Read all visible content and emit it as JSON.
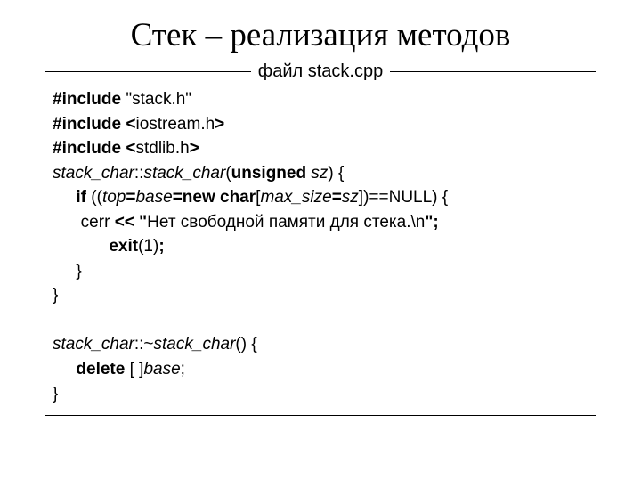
{
  "title": "Стек – реализация методов",
  "fileLabel": "файл stack.cpp",
  "code": {
    "l1a": "#include ",
    "l1b": "\"stack.h\"",
    "l2a": "#include ",
    "l2b": "<",
    "l2c": "iostream.h",
    "l2d": ">",
    "l3a": "#include ",
    "l3b": "<",
    "l3c": "stdlib.h",
    "l3d": ">",
    "l4a": "stack_char",
    "l4b": "::",
    "l4c": "stack_char",
    "l4d": "(",
    "l4e": "unsigned ",
    "l4f": "sz",
    "l4g": ") {",
    "l5a": "     ",
    "l5b": "if ",
    "l5c": "((",
    "l5d": "top",
    "l5e": "=",
    "l5f": "base",
    "l5g": "=new char",
    "l5h": "[",
    "l5i": "max_size",
    "l5j": "=",
    "l5k": "sz",
    "l5l": "])==NULL) {",
    "l6a": "      cerr ",
    "l6b": "<< \"",
    "l6c": "Нет свободной памяти для стека.\\n",
    "l6d": "\";",
    "l7a": "            exit",
    "l7b": "(1)",
    "l7c": ";",
    "l8": "     }",
    "l9": "}",
    "l10": " ",
    "l11a": "stack_char",
    "l11b": "::~",
    "l11c": "stack_char",
    "l11d": "() {",
    "l12a": "     ",
    "l12b": "delete ",
    "l12c": "[ ]",
    "l12d": "base",
    "l12e": ";",
    "l13": "}"
  }
}
